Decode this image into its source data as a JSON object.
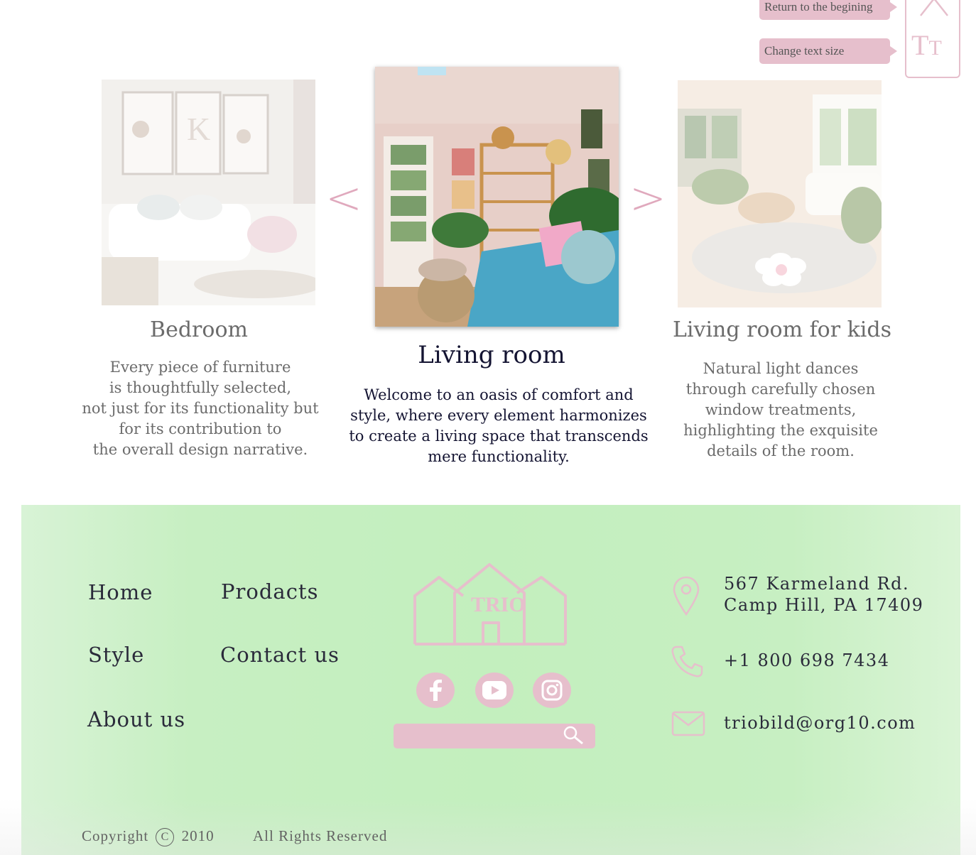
{
  "helpers": {
    "return_top_label": "Return to the begining",
    "text_size_label": "Change text size",
    "text_size_icon_big": "T",
    "text_size_icon_small": "T"
  },
  "carousel": {
    "prev_arrow": "<",
    "next_arrow": ">",
    "cards": [
      {
        "title": "Bedroom",
        "text": "Every piece of furniture\nis thoughtfully selected,\nnot just for its functionality but\nfor its contribution to\nthe overall design narrative."
      },
      {
        "title": "Living room",
        "text": "Welcome to an oasis of comfort and\nstyle, where every element harmonizes\nto create a living space that transcends\nmere functionality."
      },
      {
        "title": "Living room for kids",
        "text": "Natural light dances\nthrough carefully chosen\nwindow treatments,\nhighlighting the exquisite\ndetails of the room."
      }
    ]
  },
  "footer": {
    "nav": {
      "home": "Home",
      "products": "Prodacts",
      "style": "Style",
      "contact": "Contact us",
      "about": "About us"
    },
    "logo_text": "TRIO",
    "social": [
      "facebook-icon",
      "youtube-icon",
      "instagram-icon"
    ],
    "search": {
      "value": "",
      "placeholder": ""
    },
    "contact": {
      "address": "567 Karmeland Rd.\nCamp Hill, PA 17409",
      "phone": "+1 800 698 7434",
      "email": "triobild@org10.com"
    },
    "copyright": {
      "prefix": "Copyright",
      "symbol": "C",
      "year": "2010",
      "rights": "All Rights Reserved"
    }
  },
  "colors": {
    "accent_pink": "#e6bfcc",
    "footer_green": "#c3efbe",
    "dark_text": "#141432"
  }
}
